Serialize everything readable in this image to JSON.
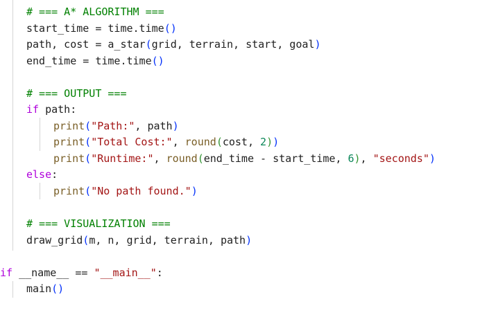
{
  "editor": {
    "lines": [
      [
        {
          "t": "# === A* ALGORITHM ===",
          "c": "com"
        }
      ],
      [
        {
          "t": "start_time = time.time",
          "c": "plain"
        },
        {
          "t": "()",
          "c": "p1"
        }
      ],
      [
        {
          "t": "path, cost = a_star",
          "c": "plain"
        },
        {
          "t": "(",
          "c": "p1"
        },
        {
          "t": "grid, terrain, start, goal",
          "c": "plain"
        },
        {
          "t": ")",
          "c": "p1"
        }
      ],
      [
        {
          "t": "end_time = time.time",
          "c": "plain"
        },
        {
          "t": "()",
          "c": "p1"
        }
      ],
      [],
      [
        {
          "t": "# === OUTPUT ===",
          "c": "com"
        }
      ],
      [
        {
          "t": "if",
          "c": "kw"
        },
        {
          "t": " path:",
          "c": "plain"
        }
      ],
      [
        {
          "t": "print",
          "c": "fn"
        },
        {
          "t": "(",
          "c": "p1"
        },
        {
          "t": "\"Path:\"",
          "c": "str"
        },
        {
          "t": ", path",
          "c": "plain"
        },
        {
          "t": ")",
          "c": "p1"
        }
      ],
      [
        {
          "t": "print",
          "c": "fn"
        },
        {
          "t": "(",
          "c": "p1"
        },
        {
          "t": "\"Total Cost:\"",
          "c": "str"
        },
        {
          "t": ", ",
          "c": "plain"
        },
        {
          "t": "round",
          "c": "fn"
        },
        {
          "t": "(",
          "c": "p2"
        },
        {
          "t": "cost, ",
          "c": "plain"
        },
        {
          "t": "2",
          "c": "num"
        },
        {
          "t": ")",
          "c": "p2"
        },
        {
          "t": ")",
          "c": "p1"
        }
      ],
      [
        {
          "t": "print",
          "c": "fn"
        },
        {
          "t": "(",
          "c": "p1"
        },
        {
          "t": "\"Runtime:\"",
          "c": "str"
        },
        {
          "t": ", ",
          "c": "plain"
        },
        {
          "t": "round",
          "c": "fn"
        },
        {
          "t": "(",
          "c": "p2"
        },
        {
          "t": "end_time - start_time, ",
          "c": "plain"
        },
        {
          "t": "6",
          "c": "num"
        },
        {
          "t": ")",
          "c": "p2"
        },
        {
          "t": ", ",
          "c": "plain"
        },
        {
          "t": "\"seconds\"",
          "c": "str"
        },
        {
          "t": ")",
          "c": "p1"
        }
      ],
      [
        {
          "t": "else",
          "c": "kw"
        },
        {
          "t": ":",
          "c": "plain"
        }
      ],
      [
        {
          "t": "print",
          "c": "fn"
        },
        {
          "t": "(",
          "c": "p1"
        },
        {
          "t": "\"No path found.\"",
          "c": "str"
        },
        {
          "t": ")",
          "c": "p1"
        }
      ],
      [],
      [
        {
          "t": "# === VISUALIZATION ===",
          "c": "com"
        }
      ],
      [
        {
          "t": "draw_grid",
          "c": "plain"
        },
        {
          "t": "(",
          "c": "p1"
        },
        {
          "t": "m, n, grid, terrain, path",
          "c": "plain"
        },
        {
          "t": ")",
          "c": "p1"
        }
      ],
      [],
      [
        {
          "t": "if",
          "c": "kw"
        },
        {
          "t": " __name__ == ",
          "c": "plain"
        },
        {
          "t": "\"__main__\"",
          "c": "str"
        },
        {
          "t": ":",
          "c": "plain"
        }
      ],
      [
        {
          "t": "main",
          "c": "plain"
        },
        {
          "t": "()",
          "c": "p1"
        }
      ]
    ]
  }
}
